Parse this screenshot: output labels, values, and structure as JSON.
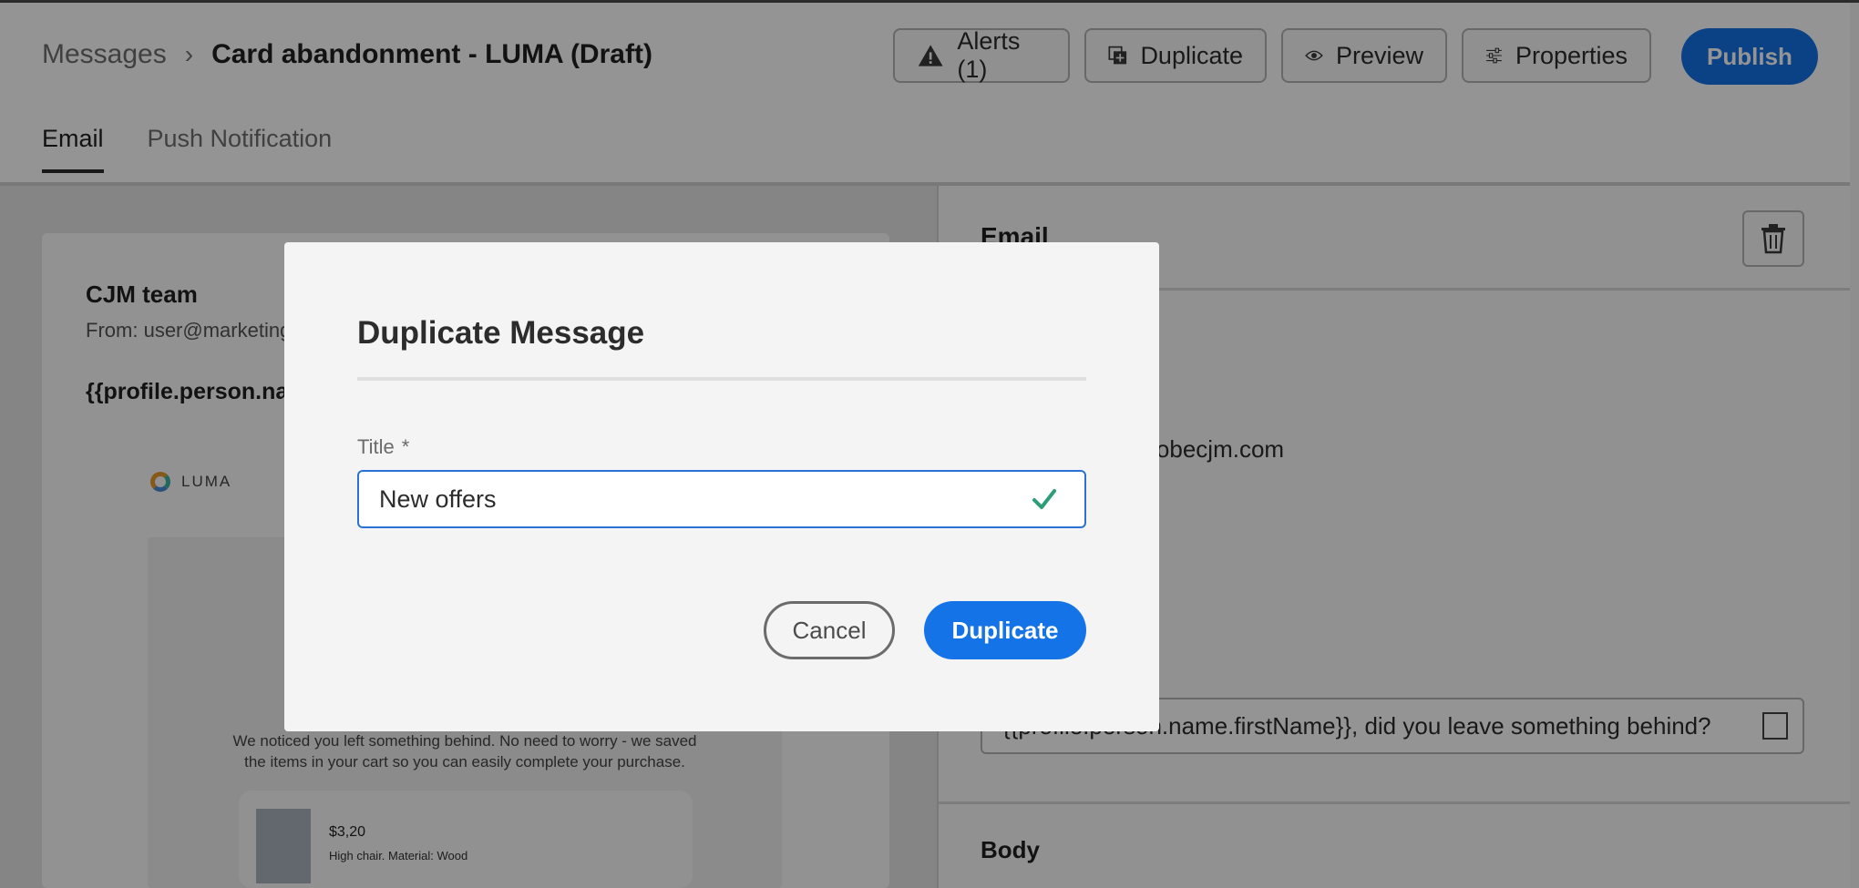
{
  "header": {
    "breadcrumb_parent": "Messages",
    "breadcrumb_sep": "›",
    "title": "Card abandonment - LUMA (Draft)",
    "buttons": {
      "alerts": "Alerts (1)",
      "duplicate": "Duplicate",
      "preview": "Preview",
      "properties": "Properties",
      "publish": "Publish"
    }
  },
  "tabs": [
    {
      "label": "Email",
      "active": true
    },
    {
      "label": "Push Notification",
      "active": false
    }
  ],
  "preview": {
    "sender_name": "CJM team",
    "from_label": "From:",
    "from_address": "user@marketing",
    "subject": "{{profile.person.na",
    "logo_text": "LUMA",
    "notice": "We noticed you left something behind. No need to worry - we saved the items in your cart so you can easily complete your purchase.",
    "product": {
      "price": "$3,20",
      "description": "High chair. Material: Wood"
    }
  },
  "properties": {
    "section_title": "Email",
    "address_partial": "adobecjm.com",
    "subject_value": "{{profile.person.name.firstName}}, did you leave something behind?",
    "body_title": "Body"
  },
  "dialog": {
    "title": "Duplicate Message",
    "field_label": "Title",
    "required_mark": "*",
    "field_value": "New offers",
    "cancel_label": "Cancel",
    "confirm_label": "Duplicate"
  },
  "colors": {
    "accent": "#1473e6",
    "valid_check": "#2d9d78",
    "input_border": "#2b72d7"
  }
}
